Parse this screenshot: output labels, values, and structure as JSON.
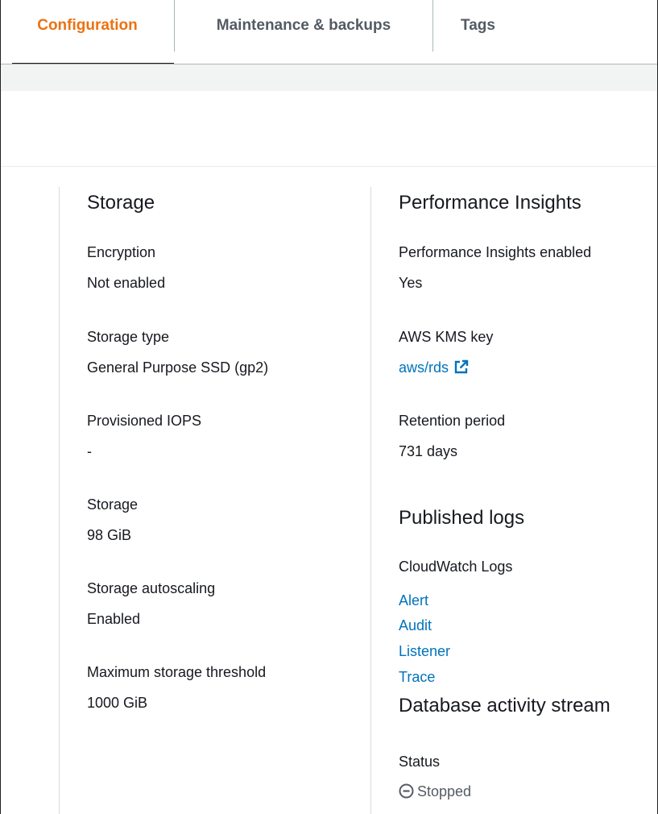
{
  "tabs": [
    {
      "label": "Configuration",
      "active": true
    },
    {
      "label": "Maintenance & backups",
      "active": false
    },
    {
      "label": "Tags",
      "active": false
    }
  ],
  "storage": {
    "heading": "Storage",
    "fields": [
      {
        "label": "Encryption",
        "value": "Not enabled"
      },
      {
        "label": "Storage type",
        "value": "General Purpose SSD (gp2)"
      },
      {
        "label": "Provisioned IOPS",
        "value": "-"
      },
      {
        "label": "Storage",
        "value": "98 GiB"
      },
      {
        "label": "Storage autoscaling",
        "value": "Enabled"
      },
      {
        "label": "Maximum storage threshold",
        "value": "1000 GiB"
      }
    ]
  },
  "performance_insights": {
    "heading": "Performance Insights",
    "enabled_label": "Performance Insights enabled",
    "enabled_value": "Yes",
    "kms_label": "AWS KMS key",
    "kms_link": "aws/rds",
    "retention_label": "Retention period",
    "retention_value": "731 days"
  },
  "published_logs": {
    "heading": "Published logs",
    "cloudwatch_label": "CloudWatch Logs",
    "links": [
      "Alert",
      "Audit",
      "Listener",
      "Trace"
    ]
  },
  "activity_stream": {
    "heading": "Database activity stream",
    "status_label": "Status",
    "status_value": "Stopped",
    "status_icon": "stopped-circle-icon"
  },
  "colors": {
    "accent": "#ec7211",
    "link": "#0073bb",
    "text": "#16191f"
  }
}
